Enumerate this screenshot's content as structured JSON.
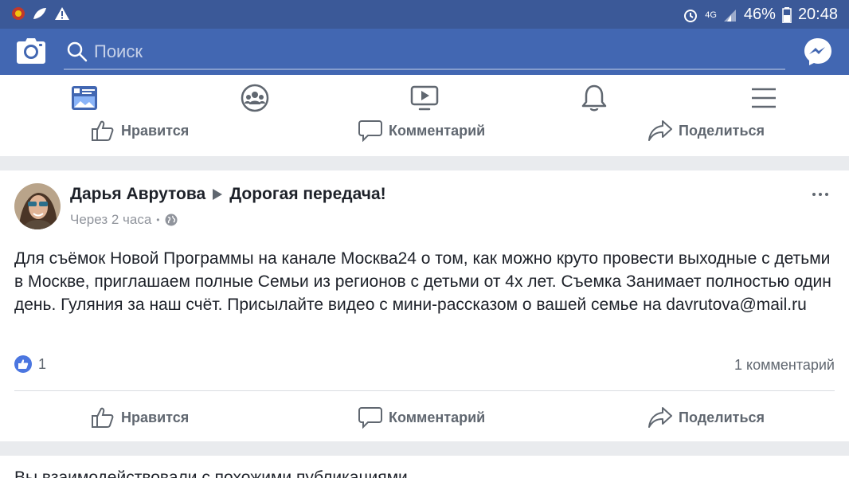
{
  "status_bar": {
    "battery": "46%",
    "time": "20:48",
    "network": "4G"
  },
  "app_bar": {
    "search_placeholder": "Поиск"
  },
  "nav": {
    "items": [
      "news-feed",
      "groups",
      "watch",
      "notifications",
      "menu"
    ]
  },
  "actions": {
    "like": "Нравится",
    "comment": "Комментарий",
    "share": "Поделиться"
  },
  "post": {
    "author": "Дарья Аврутова",
    "group": "Дорогая передача!",
    "time": "Через 2 часа",
    "privacy_sep": "•",
    "text": "Для съёмок Новой Программы на канале Москва24 о том, как можно круто провести выходные с детьми в Москве, приглашаем полные Семьи из регионов с детьми от 4х лет. Съемка Занимает полностью один день. Гуляния за наш счёт. Присылайте видео с мини-рассказом о вашей семье на davrutova@mail.ru",
    "likes": "1",
    "comments": "1 комментарий"
  },
  "next_section": {
    "text": "Вы взаимодействовали с похожими публикациями"
  },
  "colors": {
    "brand": "#4267b2",
    "status": "#3b5998",
    "active_nav": "#4267b2",
    "text_secondary": "#606770"
  }
}
